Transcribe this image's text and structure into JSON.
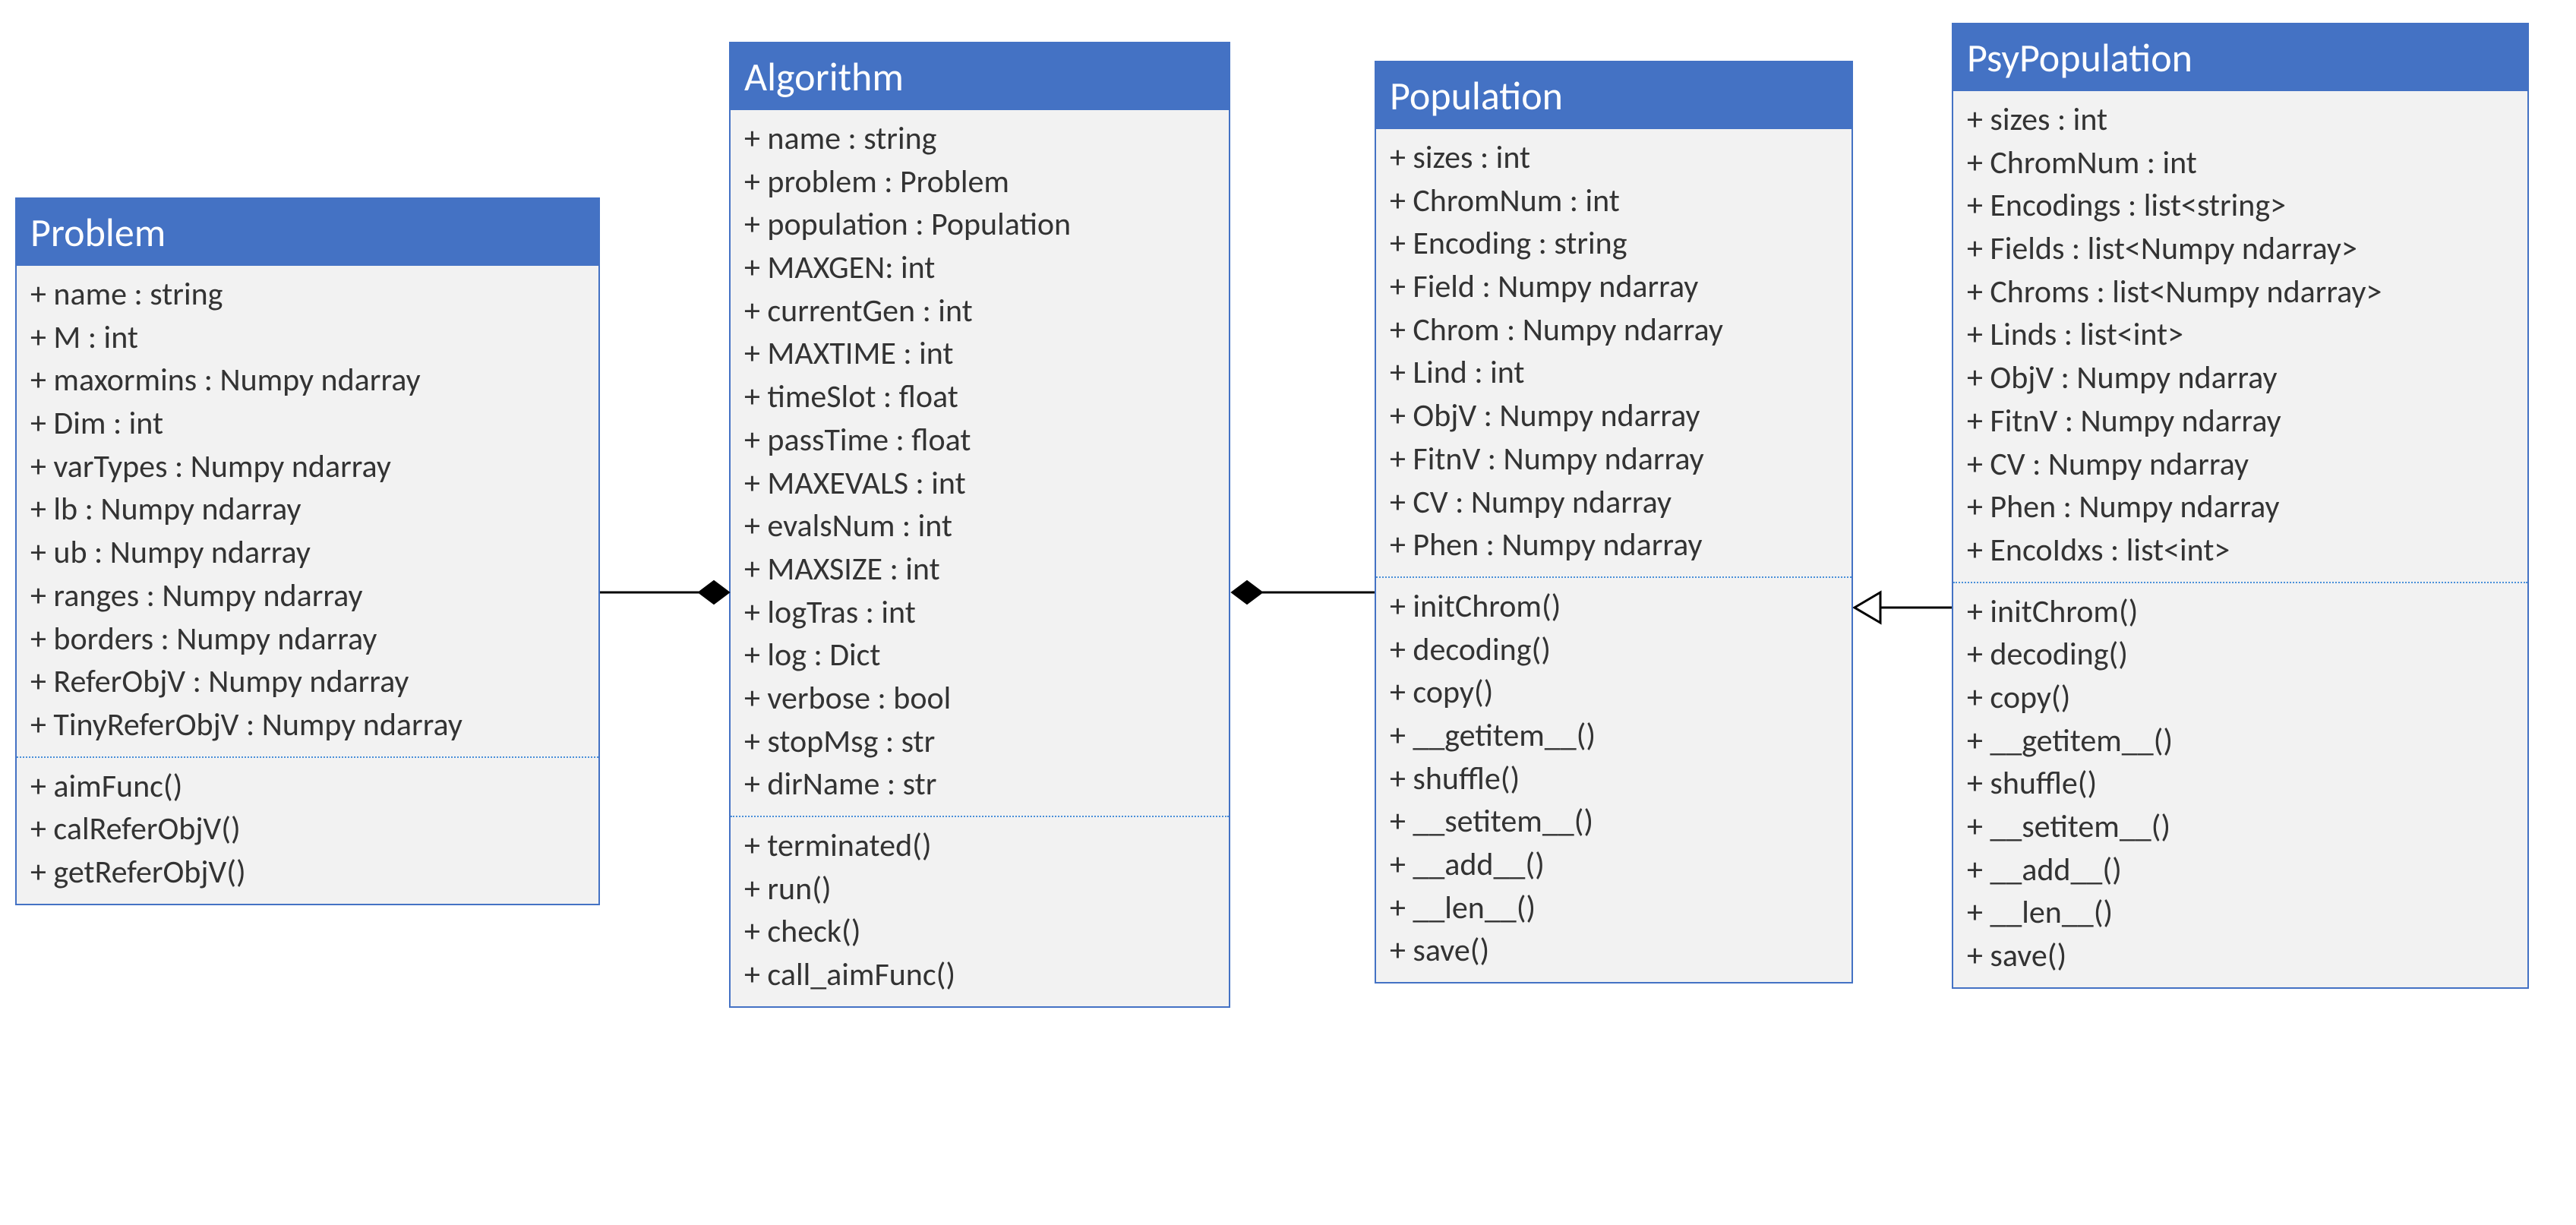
{
  "classes": {
    "problem": {
      "title": "Problem",
      "attributes": [
        "+ name : string",
        "+ M : int",
        "+ maxormins : Numpy ndarray",
        "+ Dim : int",
        "+ varTypes : Numpy ndarray",
        "+ lb : Numpy ndarray",
        "+ ub : Numpy ndarray",
        "+ ranges : Numpy ndarray",
        "+ borders : Numpy ndarray",
        "+ ReferObjV : Numpy ndarray",
        "+ TinyReferObjV : Numpy ndarray"
      ],
      "methods": [
        "+ aimFunc()",
        "+ calReferObjV()",
        "+ getReferObjV()"
      ]
    },
    "algorithm": {
      "title": "Algorithm",
      "attributes": [
        "+ name : string",
        "+ problem : Problem",
        "+ population : Population",
        "+ MAXGEN: int",
        "+ currentGen : int",
        "+ MAXTIME : int",
        "+ timeSlot : float",
        "+ passTime : float",
        "+ MAXEVALS : int",
        "+ evalsNum : int",
        "+ MAXSIZE : int",
        "+ logTras : int",
        "+ log : Dict",
        "+ verbose : bool",
        "+ stopMsg : str",
        "+ dirName : str"
      ],
      "methods": [
        "+ terminated()",
        "+ run()",
        "+ check()",
        "+ call_aimFunc()"
      ]
    },
    "population": {
      "title": "Population",
      "attributes": [
        "+ sizes : int",
        "+ ChromNum : int",
        "+ Encoding : string",
        "+ Field : Numpy ndarray",
        "+ Chrom : Numpy ndarray",
        "+ Lind : int",
        "+ ObjV : Numpy ndarray",
        "+ FitnV : Numpy ndarray",
        "+ CV : Numpy ndarray",
        "+ Phen : Numpy ndarray"
      ],
      "methods": [
        "+ initChrom()",
        "+ decoding()",
        "+ copy()",
        "+ __getitem__()",
        "+ shuffle()",
        "+ __setitem__()",
        "+ __add__()",
        "+ __len__()",
        "+ save()"
      ]
    },
    "psypopulation": {
      "title": "PsyPopulation",
      "attributes": [
        "+ sizes : int",
        "+ ChromNum : int",
        "+ Encodings : list<string>",
        "+ Fields : list<Numpy ndarray>",
        "+ Chroms : list<Numpy ndarray>",
        "+ Linds : list<int>",
        "+ ObjV : Numpy ndarray",
        "+ FitnV : Numpy ndarray",
        "+ CV : Numpy ndarray",
        "+ Phen : Numpy ndarray",
        "+ EncoIdxs : list<int>"
      ],
      "methods": [
        "+ initChrom()",
        "+ decoding()",
        "+ copy()",
        "+ __getitem__()",
        "+ shuffle()",
        "+ __setitem__()",
        "+ __add__()",
        "+ __len__()",
        "+ save()"
      ]
    }
  }
}
